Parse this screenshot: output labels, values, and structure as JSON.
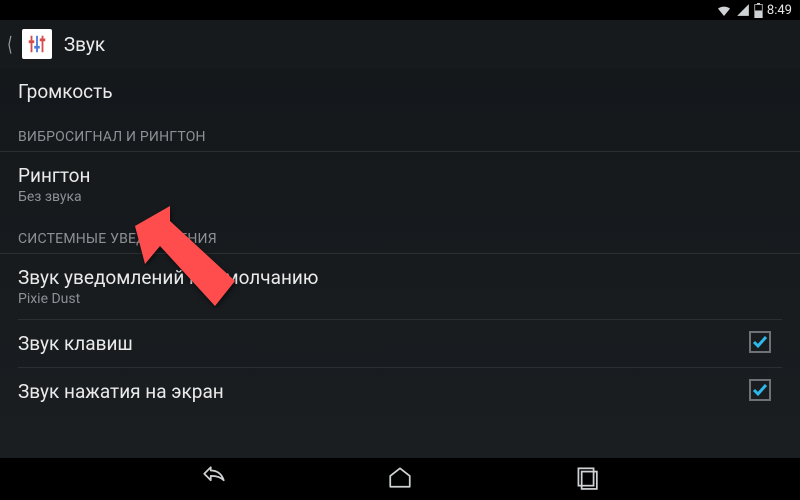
{
  "status": {
    "time": "8:49"
  },
  "header": {
    "title": "Звук"
  },
  "rows": {
    "volume": {
      "title": "Громкость"
    },
    "section_vibro": {
      "label": "ВИБРОСИГНАЛ И РИНГТОН"
    },
    "ringtone": {
      "title": "Рингтон",
      "summary": "Без звука"
    },
    "section_system": {
      "label": "СИСТЕМНЫЕ УВЕДОМЛЕНИЯ"
    },
    "notif": {
      "title": "Звук уведомлений по умолчанию",
      "summary": "Pixie Dust"
    },
    "dialpad": {
      "title": "Звук клавиш"
    },
    "touch": {
      "title": "Звук нажатия на экран"
    }
  }
}
